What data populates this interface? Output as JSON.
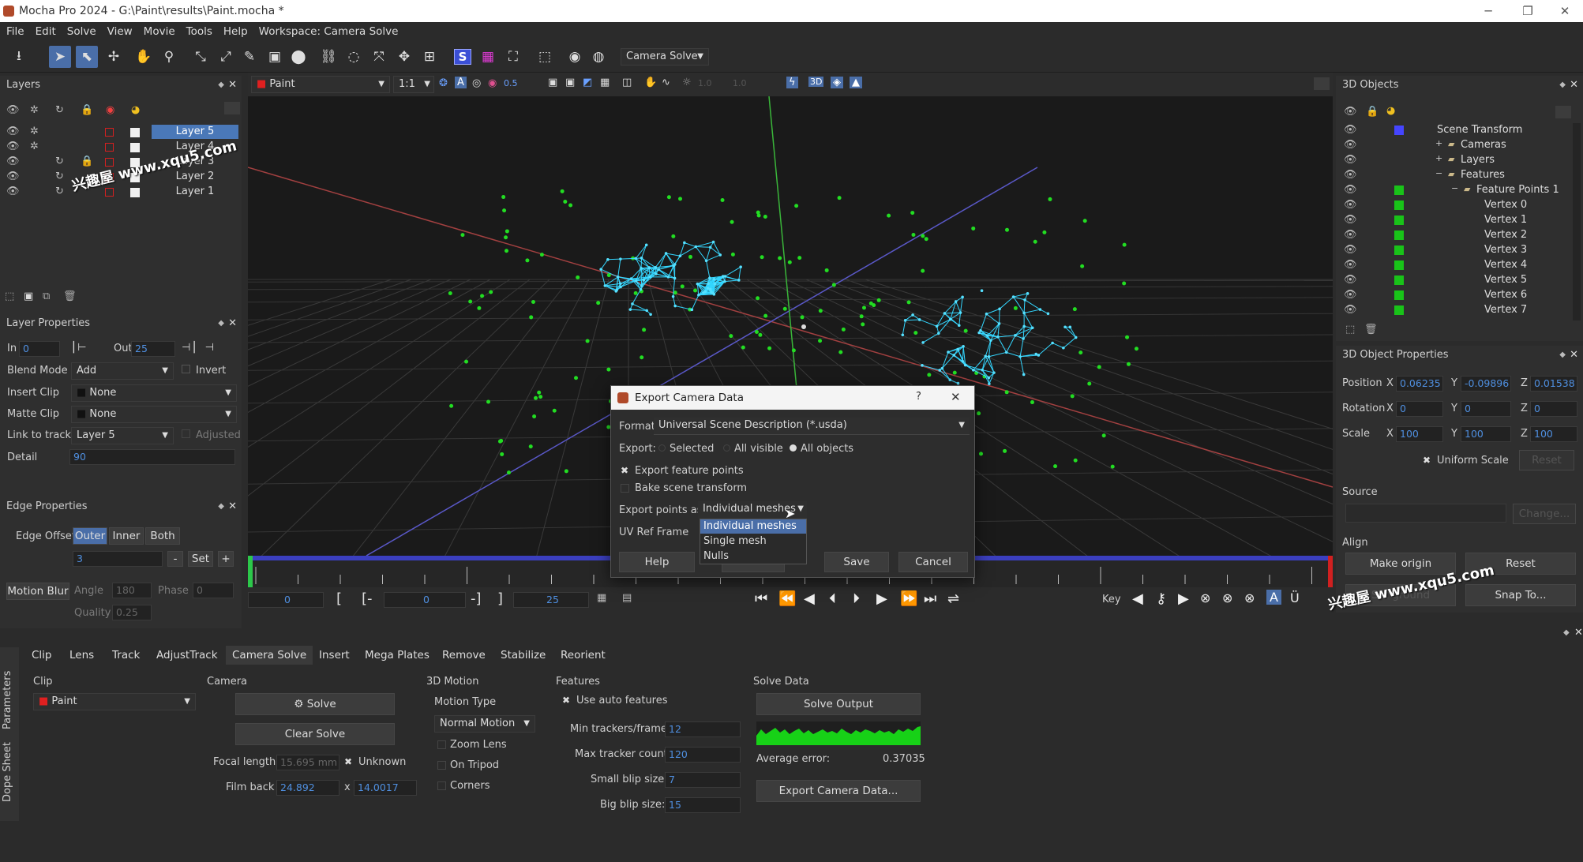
{
  "window": {
    "title": "Mocha Pro 2024 - G:\\Paint\\results\\Paint.mocha *",
    "minimize": "─",
    "maximize": "❐",
    "close": "✕"
  },
  "menu": [
    "File",
    "Edit",
    "Solve",
    "View",
    "Movie",
    "Tools",
    "Help",
    "Workspace: Camera Solve"
  ],
  "toolbar": {
    "workspace_dropdown": "Camera Solve"
  },
  "viewer_toolbar": {
    "clip": "Paint",
    "zoom": "1:1",
    "value_a": "0.5",
    "value_b": "1.0",
    "value_c": "1.0"
  },
  "layers_panel": {
    "title": "Layers",
    "items": [
      {
        "name": "Layer 5",
        "selected": true
      },
      {
        "name": "Layer 4",
        "selected": false
      },
      {
        "name": "Layer 3",
        "selected": false
      },
      {
        "name": "Layer 2",
        "selected": false
      },
      {
        "name": "Layer 1",
        "selected": false
      }
    ]
  },
  "watermark": "兴趣屋 www.xqu5.com",
  "layer_properties": {
    "title": "Layer Properties",
    "in_label": "In",
    "in_value": "0",
    "out_label": "Out",
    "out_value": "25",
    "blend_label": "Blend Mode",
    "blend_value": "Add",
    "invert": "Invert",
    "insert_label": "Insert Clip",
    "insert_value": "None",
    "matte_label": "Matte Clip",
    "matte_value": "None",
    "link_label": "Link to track",
    "link_value": "Layer 5",
    "adjusted": "Adjusted",
    "detail_label": "Detail",
    "detail_value": "90"
  },
  "edge_properties": {
    "title": "Edge Properties",
    "offset_label": "Edge Offset",
    "outer": "Outer",
    "inner": "Inner",
    "both": "Both",
    "offset_value": "3",
    "minus": "-",
    "set": "Set",
    "plus": "+",
    "motion_blur": "Motion Blur",
    "angle_label": "Angle",
    "angle_value": "180",
    "phase_label": "Phase",
    "phase_value": "0",
    "quality_label": "Quality",
    "quality_value": "0.25"
  },
  "timeline": {
    "in_frame": "0",
    "mark_in": "[",
    "mark_in2": "[-",
    "current": "0",
    "mark_out2": "-]",
    "mark_out": "]",
    "out_frame": "25",
    "key_label": "Key"
  },
  "objects_panel": {
    "title": "3D Objects",
    "tree": [
      {
        "label": "Scene Transform",
        "color": "blue",
        "indent": 0,
        "expand": ""
      },
      {
        "label": "Cameras",
        "color": "none",
        "indent": 1,
        "expand": "+"
      },
      {
        "label": "Layers",
        "color": "none",
        "indent": 1,
        "expand": "+"
      },
      {
        "label": "Features",
        "color": "none",
        "indent": 1,
        "expand": "−"
      },
      {
        "label": "Feature Points 1",
        "color": "green",
        "indent": 2,
        "expand": "−"
      },
      {
        "label": "Vertex 0",
        "color": "green",
        "indent": 3,
        "expand": ""
      },
      {
        "label": "Vertex 1",
        "color": "green",
        "indent": 3,
        "expand": ""
      },
      {
        "label": "Vertex 2",
        "color": "green",
        "indent": 3,
        "expand": ""
      },
      {
        "label": "Vertex 3",
        "color": "green",
        "indent": 3,
        "expand": ""
      },
      {
        "label": "Vertex 4",
        "color": "green",
        "indent": 3,
        "expand": ""
      },
      {
        "label": "Vertex 5",
        "color": "green",
        "indent": 3,
        "expand": ""
      },
      {
        "label": "Vertex 6",
        "color": "green",
        "indent": 3,
        "expand": ""
      },
      {
        "label": "Vertex 7",
        "color": "green",
        "indent": 3,
        "expand": ""
      }
    ]
  },
  "object_properties": {
    "title": "3D Object Properties",
    "position_label": "Position",
    "px": "0.06235",
    "py": "-0.09896",
    "pz": "0.01538",
    "rotation_label": "Rotation",
    "rx": "0",
    "ry": "0",
    "rz": "0",
    "scale_label": "Scale",
    "sx": "100",
    "sy": "100",
    "sz": "100",
    "x": "X",
    "y": "Y",
    "z": "Z",
    "uniform_scale": "Uniform Scale",
    "reset_small": "Reset",
    "source_label": "Source",
    "change": "Change...",
    "align_label": "Align",
    "make_origin": "Make origin",
    "reset": "Reset",
    "set_ground": "Set ground",
    "snap_to": "Snap To..."
  },
  "params": {
    "tabs": [
      "Clip",
      "Lens",
      "Track",
      "AdjustTrack",
      "Camera Solve",
      "Insert",
      "Mega Plates",
      "Remove",
      "Stabilize",
      "Reorient"
    ],
    "side_tabs": [
      "Parameters",
      "Dope Sheet"
    ],
    "clip_label": "Clip",
    "clip_value": "Paint",
    "camera_label": "Camera",
    "solve": "Solve",
    "clear_solve": "Clear Solve",
    "focal_label": "Focal length",
    "focal_value": "15.695 mm",
    "unknown": "Unknown",
    "filmback_label": "Film back",
    "filmback_w": "24.892",
    "filmback_x": "x",
    "filmback_h": "14.0017",
    "motion_label": "3D Motion",
    "motion_type_label": "Motion Type",
    "motion_type": "Normal Motion",
    "zoom_lens": "Zoom Lens",
    "on_tripod": "On Tripod",
    "corners": "Corners",
    "features_label": "Features",
    "use_auto": "Use auto features",
    "min_trackers_label": "Min trackers/frame",
    "min_trackers": "12",
    "max_tracker_label": "Max tracker count",
    "max_tracker": "120",
    "small_blip_label": "Small blip size:",
    "small_blip": "7",
    "big_blip_label": "Big blip size:",
    "big_blip": "15",
    "solve_data_label": "Solve Data",
    "solve_output": "Solve Output",
    "avg_error_label": "Average error:",
    "avg_error": "0.37035",
    "export_camera": "Export Camera Data..."
  },
  "dialog": {
    "title": "Export Camera Data",
    "help_q": "?",
    "close": "✕",
    "format_label": "Format:",
    "format_value": "Universal Scene Description (*.usda)",
    "export_label": "Export:",
    "opt_selected": "Selected",
    "opt_visible": "All visible",
    "opt_all": "All objects",
    "export_features": "Export feature points",
    "bake_transform": "Bake scene transform",
    "points_as_label": "Export points as",
    "points_as_value": "Individual meshes",
    "uv_label": "UV Ref Frame",
    "options": [
      "Individual meshes",
      "Single mesh",
      "Nulls"
    ],
    "help": "Help",
    "save": "Save",
    "cancel": "Cancel"
  },
  "colors": {
    "accent": "#4a6ea8",
    "grid": "#19c319",
    "layer_red": "#d42020",
    "mesh": "#33d6ff",
    "point": "#22dd22"
  }
}
